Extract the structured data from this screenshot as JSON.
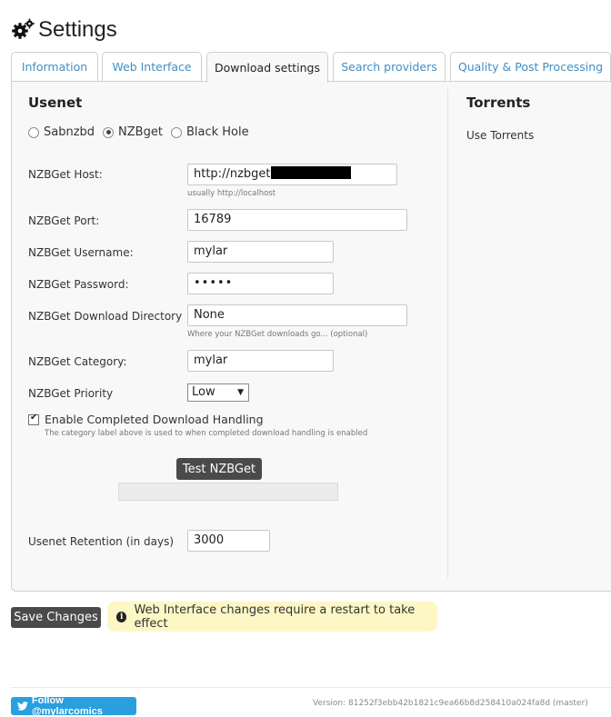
{
  "page": {
    "title": "Settings",
    "icon": "gear-icon"
  },
  "tabs": [
    {
      "label": "Information",
      "active": false
    },
    {
      "label": "Web Interface",
      "active": false
    },
    {
      "label": "Download settings",
      "active": true
    },
    {
      "label": "Search providers",
      "active": false
    },
    {
      "label": "Quality & Post Processing",
      "active": false
    }
  ],
  "usenet": {
    "title": "Usenet",
    "client_options": [
      "Sabnzbd",
      "NZBget",
      "Black Hole"
    ],
    "selected_client": "NZBget",
    "host": {
      "label": "NZBGet Host:",
      "value": "http://nzbget",
      "hint": "usually http://localhost"
    },
    "port": {
      "label": "NZBGet Port:",
      "value": "16789"
    },
    "username": {
      "label": "NZBGet Username:",
      "value": "mylar"
    },
    "password": {
      "label": "NZBGet Password:",
      "value": "•••••"
    },
    "download_dir": {
      "label": "NZBGet Download Directory",
      "value": "None",
      "hint": "Where your NZBGet downloads go... (optional)"
    },
    "category": {
      "label": "NZBGet Category:",
      "value": "mylar"
    },
    "priority": {
      "label": "NZBGet Priority",
      "value": "Low"
    },
    "completed_handling": {
      "label": "Enable Completed Download Handling",
      "checked": true,
      "hint": "The category label above is used to when completed download handling is enabled"
    },
    "test_button": "Test NZBGet",
    "retention": {
      "label": "Usenet Retention (in days)",
      "value": "3000"
    }
  },
  "torrents": {
    "title": "Torrents",
    "use_label": "Use Torrents"
  },
  "actions": {
    "save_label": "Save Changes",
    "notice": "Web Interface changes require a restart to take effect"
  },
  "footer": {
    "follow_label": "Follow @mylarcomics",
    "version": "Version: 81252f3ebb42b1821c9ea66b8d258410a024fa8d (master)"
  },
  "colors": {
    "tab_link": "#3f8fc4",
    "notice_bg": "#fdf7c6",
    "twitter": "#2a9fe0",
    "button_dark": "#4a4a4a"
  }
}
